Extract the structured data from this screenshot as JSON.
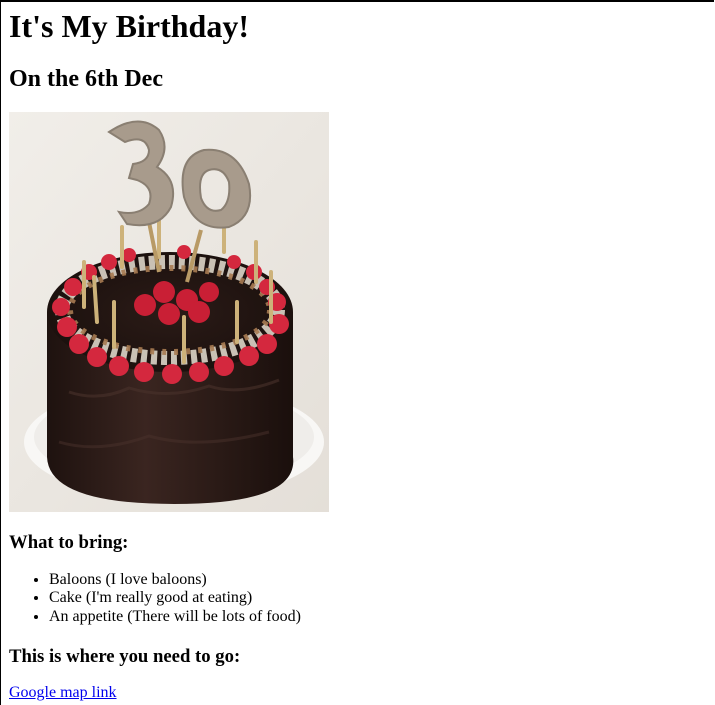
{
  "page": {
    "title": "It's My Birthday!",
    "date_heading": "On the 6th Dec"
  },
  "photo": {
    "number_topper": "30",
    "icon": "birthday-cake-image"
  },
  "bring": {
    "heading": "What to bring:",
    "items": [
      "Baloons (I love baloons)",
      "Cake (I'm really good at eating)",
      "An appetite (There will be lots of food)"
    ]
  },
  "directions": {
    "heading": "This is where you need to go:",
    "link_text": "Google map link"
  },
  "colors": {
    "link": "#0000ee",
    "text": "#000000",
    "background": "#ffffff",
    "frosting": "#2a1a16",
    "raspberry": "#d4283e",
    "topper": "#a89b8c"
  }
}
